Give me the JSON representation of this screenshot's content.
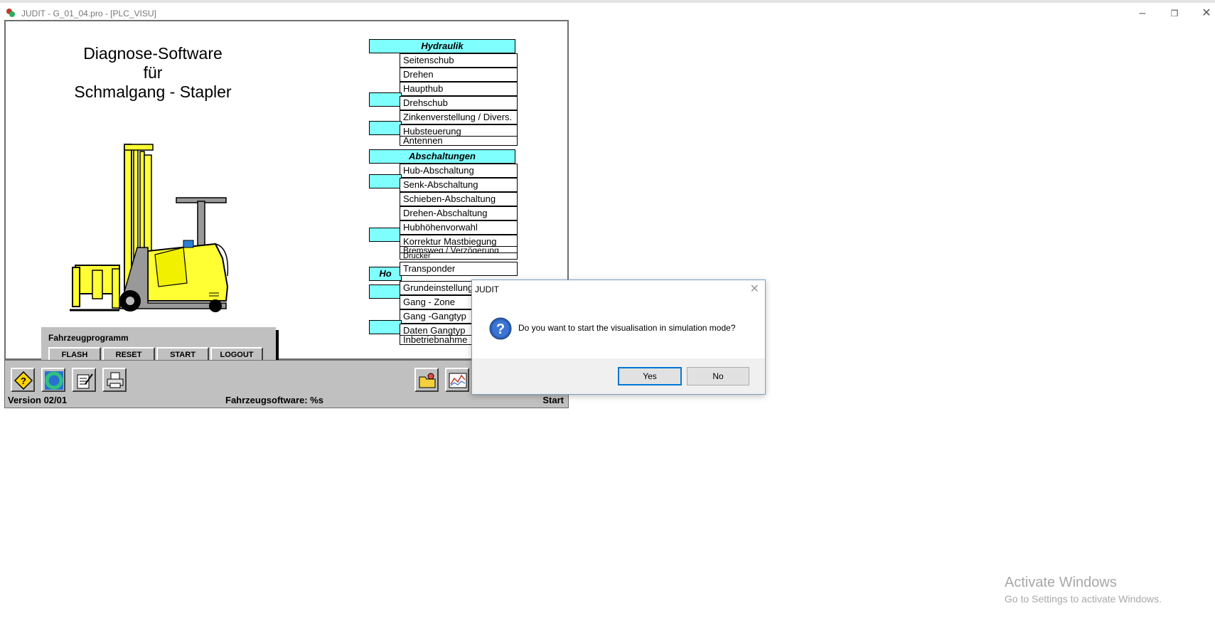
{
  "window": {
    "title": "JUDIT - G_01_04.pro - [PLC_VISU]"
  },
  "heading": {
    "line1": "Diagnose-Software",
    "line2": "für",
    "line3": "Schmalgang - Stapler"
  },
  "vehicle_program": {
    "label": "Fahrzeugprogramm",
    "buttons": [
      "FLASH",
      "RESET",
      "START",
      "LOGOUT"
    ]
  },
  "menu": {
    "header_hydraulik": "Hydraulik",
    "items_hydraulik": [
      "Seitenschub",
      "Drehen",
      "Haupthub",
      "Drehschub",
      "Zinkenverstellung / Divers.",
      "Hubsteuerung"
    ],
    "item_antennen": "Antennen",
    "header_abschaltungen": "Abschaltungen",
    "items_abschaltungen": [
      "Hub-Abschaltung",
      "Senk-Abschaltung",
      "Schieben-Abschaltung",
      "Drehen-Abschaltung",
      "Hubhöhenvorwahl",
      "Korrektur Mastbiegung"
    ],
    "item_bremsweg": "Bremsweg / Verzögerung",
    "item_drucker": "Drucker",
    "item_transponder": "Transponder",
    "header_partial": "Ho",
    "items_lower": [
      "Grundeinstellung",
      "Gang - Zone",
      "Gang -Gangtyp",
      "Daten Gangtyp"
    ],
    "item_inbetrieb": "Inbetriebnahme"
  },
  "status": {
    "version": "Version 02/01",
    "software": "Fahrzeugsoftware: %s",
    "state": "Start"
  },
  "dialog": {
    "title": "JUDIT",
    "message": "Do you want to start the visualisation in simulation mode?",
    "yes": "Yes",
    "no": "No"
  },
  "watermark": {
    "line1": "Activate Windows",
    "line2": "Go to Settings to activate Windows."
  },
  "colors": {
    "menu_header": "#80ffff",
    "panel": "#c0c0c0",
    "truck_yellow": "#ffff33"
  },
  "icons": [
    "help-diamond-icon",
    "cycle-icon",
    "notepad-icon",
    "printer-icon",
    "folder-icon",
    "chart-icon",
    "question-icon"
  ]
}
